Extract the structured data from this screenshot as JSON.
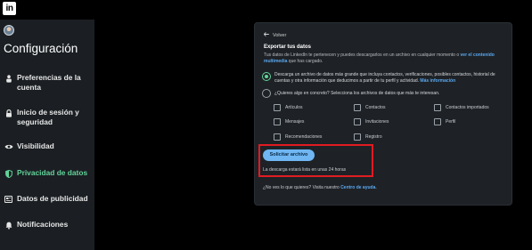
{
  "topbar": {
    "logo_text": "in"
  },
  "sidebar": {
    "title": "Configuración",
    "items": [
      {
        "label_line1": "Preferencias de la",
        "label_line2": "cuenta",
        "icon": "person-icon",
        "active": false
      },
      {
        "label_line1": "Inicio de sesión y",
        "label_line2": "seguridad",
        "icon": "lock-icon",
        "active": false
      },
      {
        "label_line1": "Visibilidad",
        "label_line2": "",
        "icon": "eye-icon",
        "active": false
      },
      {
        "label_line1": "Privacidad de datos",
        "label_line2": "",
        "icon": "shield-icon",
        "active": true
      },
      {
        "label_line1": "Datos de publicidad",
        "label_line2": "",
        "icon": "newspaper-icon",
        "active": false
      },
      {
        "label_line1": "Notificaciones",
        "label_line2": "",
        "icon": "bell-icon",
        "active": false
      }
    ]
  },
  "card": {
    "back_label": "Volver",
    "section_title": "Exportar tus datos",
    "description_pre": "Tus datos de LinkedIn te pertenecen y puedes descargarlos en un archivo en cualquier momento o ",
    "description_link": "ver el contenido multimedia",
    "description_post": " que has cargado.",
    "option1_text": "Descarga un archivo de datos más grande que incluya contactos, verificaciones, posibles contactos, historial de cuentas y otra información que deducimos a partir de tu perfil y actividad. ",
    "option1_link": "Más información",
    "option2_text": "¿Quieres algo en concreto? Selecciona los archivos de datos que más te interesan.",
    "checkboxes": [
      "Artículos",
      "Contactos",
      "Contactos importados",
      "Mensajes",
      "Invitaciones",
      "Perfil",
      "Recomendaciones",
      "Registro"
    ],
    "request_button": "Solicitar archivo",
    "eta_text": "La descarga estará lista en unas 24 horas",
    "help_pre": "¿No ves lo que quieres? Visita nuestro ",
    "help_link": "Centro de ayuda",
    "help_post": "."
  },
  "colors": {
    "accent_green": "#62d39a",
    "link_blue": "#5aa8f0",
    "button_blue": "#6fb6f2",
    "highlight_red": "#e11b22"
  }
}
